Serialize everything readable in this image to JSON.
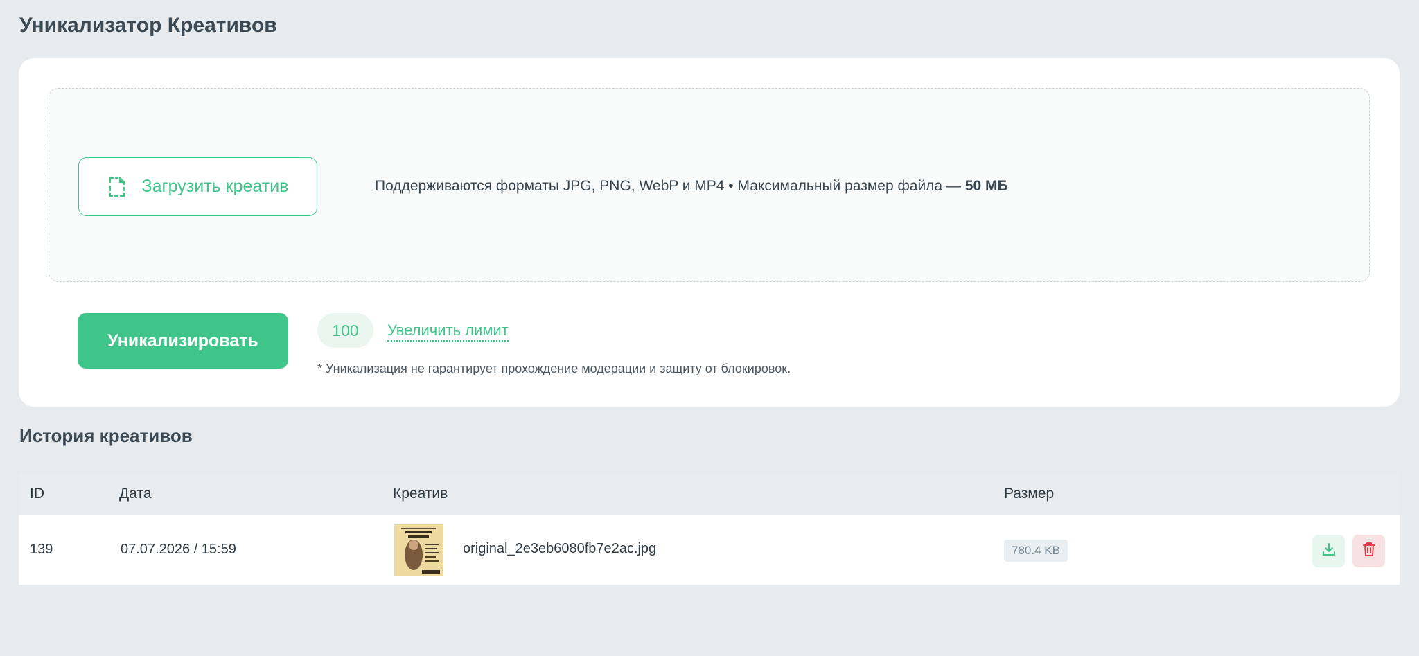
{
  "page": {
    "title": "Уникализатор Креативов"
  },
  "upload": {
    "button_label": "Загрузить креатив",
    "formats_text": "Поддерживаются форматы JPG, PNG, WebP и MP4 • Максимальный размер файла —",
    "max_size": "50 МБ"
  },
  "actions": {
    "uniqueize_label": "Уникализировать",
    "counter": "100",
    "increase_limit_label": "Увеличить лимит",
    "disclaimer": "* Уникализация не гарантирует прохождение модерации и защиту от блокировок."
  },
  "history": {
    "title": "История креативов",
    "columns": {
      "id": "ID",
      "date": "Дата",
      "creative": "Креатив",
      "size": "Размер"
    },
    "rows": [
      {
        "id": "139",
        "date": "07.07.2026 / 15:59",
        "filename": "original_2e3eb6080fb7e2ac.jpg",
        "size": "780.4 KB"
      }
    ]
  },
  "icons": {
    "upload": "file-dashed-icon",
    "download": "download-icon",
    "delete": "trash-icon",
    "thumbnail": "image-thumbnail"
  },
  "colors": {
    "accent": "#3fc58a",
    "background": "#e7ebee",
    "card": "#ffffff",
    "danger": "#d9404c",
    "danger_bg": "#f8e1e3"
  }
}
